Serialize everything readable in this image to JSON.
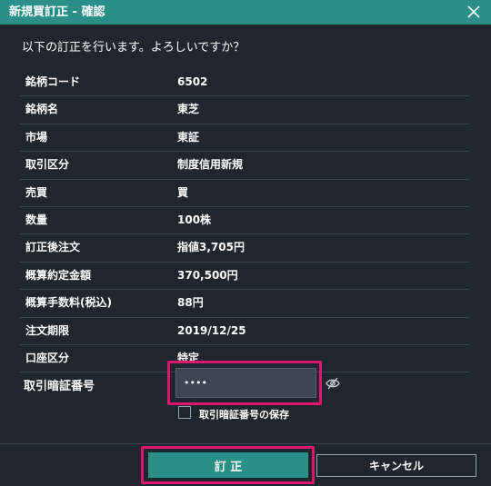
{
  "dialog": {
    "title": "新規買訂正 - 確認",
    "question": "以下の訂正を行います。よろしいですか？"
  },
  "rows": [
    {
      "label": "銘柄コード",
      "value": "6502"
    },
    {
      "label": "銘柄名",
      "value": "東芝"
    },
    {
      "label": "市場",
      "value": "東証"
    },
    {
      "label": "取引区分",
      "value": "制度信用新規"
    },
    {
      "label": "売買",
      "value": "買"
    },
    {
      "label": "数量",
      "value": "100株"
    },
    {
      "label": "訂正後注文",
      "value": "指値3,705円"
    },
    {
      "label": "概算約定金額",
      "value": "370,500円"
    },
    {
      "label": "概算手数料(税込)",
      "value": "88円"
    },
    {
      "label": "注文期限",
      "value": "2019/12/25"
    },
    {
      "label": "口座区分",
      "value": "特定"
    }
  ],
  "pin": {
    "label": "取引暗証番号",
    "value": "••••",
    "save_label": "取引暗証番号の保存",
    "save_checked": false
  },
  "buttons": {
    "ok": "訂 正",
    "cancel": "キャンセル"
  },
  "colors": {
    "accent": "#2a9087",
    "highlight": "#e0166a",
    "background": "#1f262d"
  },
  "icons": {
    "close": "close-icon",
    "eye": "eye-slash-icon"
  }
}
